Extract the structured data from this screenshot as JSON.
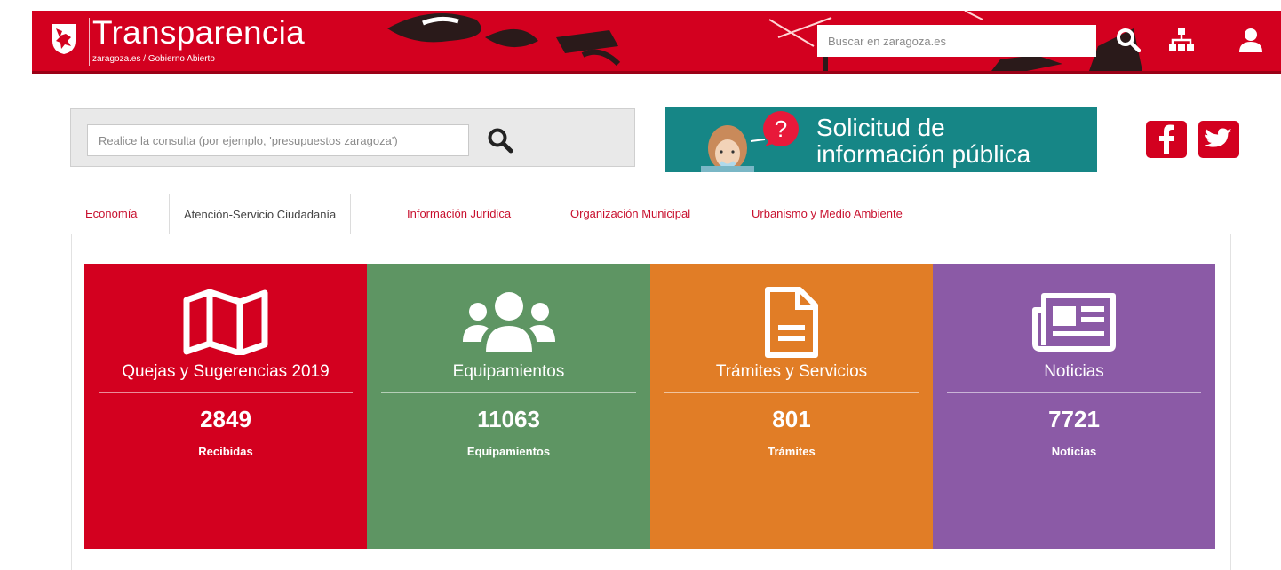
{
  "header": {
    "title": "Transparencia",
    "breadcrumb": [
      "zaragoza.es",
      "Gobierno Abierto"
    ],
    "breadcrumb_sep": "/",
    "search_placeholder": "Buscar en zaragoza.es",
    "icons": [
      "search-icon",
      "sitemap-icon",
      "user-icon"
    ]
  },
  "query": {
    "placeholder": "Realice la consulta (por ejemplo, 'presupuestos zaragoza')"
  },
  "banner": {
    "line1": "Solicitud de",
    "line2": "información pública"
  },
  "social": [
    "facebook-icon",
    "twitter-icon"
  ],
  "tabs": [
    {
      "label": "Economía",
      "active": false
    },
    {
      "label": "Atención-Servicio Ciudadanía",
      "active": true
    },
    {
      "label": "Información Jurídica",
      "active": false
    },
    {
      "label": "Organización Municipal",
      "active": false
    },
    {
      "label": "Urbanismo y Medio Ambiente",
      "active": false
    }
  ],
  "cards": [
    {
      "title": "Quejas y Sugerencias 2019",
      "count": "2849",
      "sub": "Recibidas",
      "icon": "map-icon",
      "color": "#d3001f"
    },
    {
      "title": "Equipamientos",
      "count": "11063",
      "sub": "Equipamientos",
      "icon": "users-icon",
      "color": "#5e9563"
    },
    {
      "title": "Trámites y Servicios",
      "count": "801",
      "sub": "Trámites",
      "icon": "document-icon",
      "color": "#e17d26"
    },
    {
      "title": "Noticias",
      "count": "7721",
      "sub": "Noticias",
      "icon": "newspaper-icon",
      "color": "#8b5aa6"
    }
  ],
  "colors": {
    "brand_red": "#d3001f",
    "teal_banner": "#168686",
    "tab_link": "#c8102e"
  }
}
